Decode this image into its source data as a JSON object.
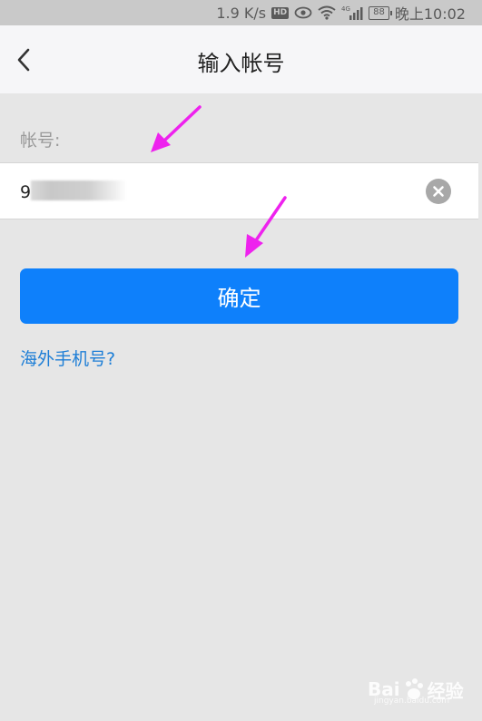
{
  "status_bar": {
    "speed": "1.9 K/s",
    "hd": "HD",
    "network": "4G",
    "battery": "88",
    "time": "晚上10:02"
  },
  "nav": {
    "title": "输入帐号"
  },
  "form": {
    "account_label": "帐号:",
    "account_value": "9",
    "confirm_label": "确定",
    "overseas_link": "海外手机号?"
  },
  "watermark": {
    "brand": "Bai",
    "brand_cn": "经验",
    "url": "jingyan.baidu.com"
  },
  "colors": {
    "primary": "#0e80fb",
    "link": "#1d7ed6",
    "annotation_arrow": "#ee22ee",
    "background": "#e6e6e6"
  }
}
